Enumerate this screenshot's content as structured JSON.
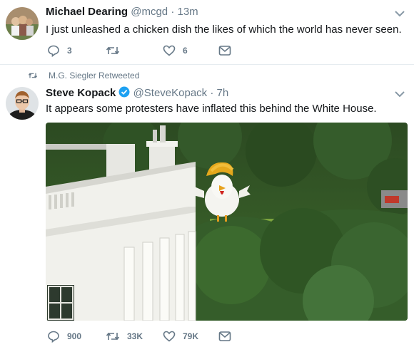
{
  "tweet1": {
    "author_name": "Michael Dearing",
    "handle": "@mcgd",
    "time": "13m",
    "text": "I just unleashed a chicken dish the likes of which the world has never seen.",
    "replies": "3",
    "retweets": "",
    "likes": "6"
  },
  "retweet_header": {
    "label": "M.G. Siegler Retweeted"
  },
  "tweet2": {
    "author_name": "Steve Kopack",
    "handle": "@SteveKopack",
    "time": "7h",
    "verified": true,
    "text": "It appears some protesters have inflated this behind the White House.",
    "replies": "900",
    "retweets": "33K",
    "likes": "79K"
  },
  "colors": {
    "meta": "#657786",
    "divider": "#e6ecf0",
    "verified": "#1da1f2"
  },
  "icons": [
    "reply-icon",
    "retweet-icon",
    "like-icon",
    "dm-icon",
    "chevron-down-icon",
    "verified-icon"
  ]
}
